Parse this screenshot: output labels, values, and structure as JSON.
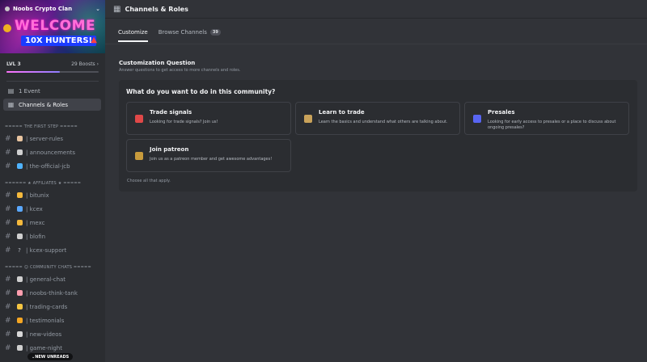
{
  "server": {
    "name": "Noobs Crypto Clan",
    "banner_text_1": "WELCOME",
    "banner_text_2": "10X HUNTERS!",
    "level": "LVL 3",
    "boosts": "29 Boosts",
    "boost_progress_percent": 58
  },
  "nav": {
    "events_label": "1 Event",
    "channels_roles_label": "Channels & Roles"
  },
  "categories": {
    "first_step": "THE FIRST STEP",
    "affiliates": "AFFILIATES",
    "community": "COMMUNITY CHATS"
  },
  "channels": [
    {
      "name": "server-rules",
      "color": "#e8c4a0"
    },
    {
      "name": "announcements",
      "color": "#d0d0d0"
    },
    {
      "name": "the-official-jcb",
      "color": "#4fb3ff"
    },
    {
      "name": "bitunix",
      "color": "#f5b93c"
    },
    {
      "name": "kcex",
      "color": "#5aa8ff"
    },
    {
      "name": "mexc",
      "color": "#f5b93c"
    },
    {
      "name": "blofin",
      "color": "#cfcfcf"
    },
    {
      "name": "kcex-support",
      "color": "#dddddd"
    },
    {
      "name": "general-chat",
      "color": "#cfcfcf"
    },
    {
      "name": "noobs-think-tank",
      "color": "#ff9fb0"
    },
    {
      "name": "trading-cards",
      "color": "#f5c542"
    },
    {
      "name": "testimonials",
      "color": "#f5a623"
    },
    {
      "name": "new-videos",
      "color": "#d8d8d8"
    },
    {
      "name": "game-night",
      "color": "#cfcfcf"
    }
  ],
  "new_unreads": "NEW UNREADS",
  "header": {
    "title": "Channels & Roles"
  },
  "tabs": {
    "customize": "Customize",
    "browse": "Browse Channels",
    "browse_count": "39"
  },
  "section": {
    "title": "Customization Question",
    "subtitle": "Answer questions to get access to more channels and roles."
  },
  "question": {
    "title": "What do you want to do in this community?",
    "footer": "Choose all that apply.",
    "options": [
      {
        "title": "Trade signals",
        "desc": "Looking for trade signals? Join us!",
        "color": "#e04848"
      },
      {
        "title": "Learn to trade",
        "desc": "Learn the basics and understand what others are talking about.",
        "color": "#c9a25a"
      },
      {
        "title": "Presales",
        "desc": "Looking for early access to presales or a place to discuss about ongoing presales?",
        "color": "#5865f2"
      },
      {
        "title": "Join patreon",
        "desc": "Join us as a patreon member and get awesome advantages!",
        "color": "#c89b3c"
      }
    ]
  },
  "icons": {
    "event": "calendar-icon",
    "channels": "channels-roles-icon",
    "hash": "hashtag-icon",
    "chevron": "chevron-down-icon"
  }
}
